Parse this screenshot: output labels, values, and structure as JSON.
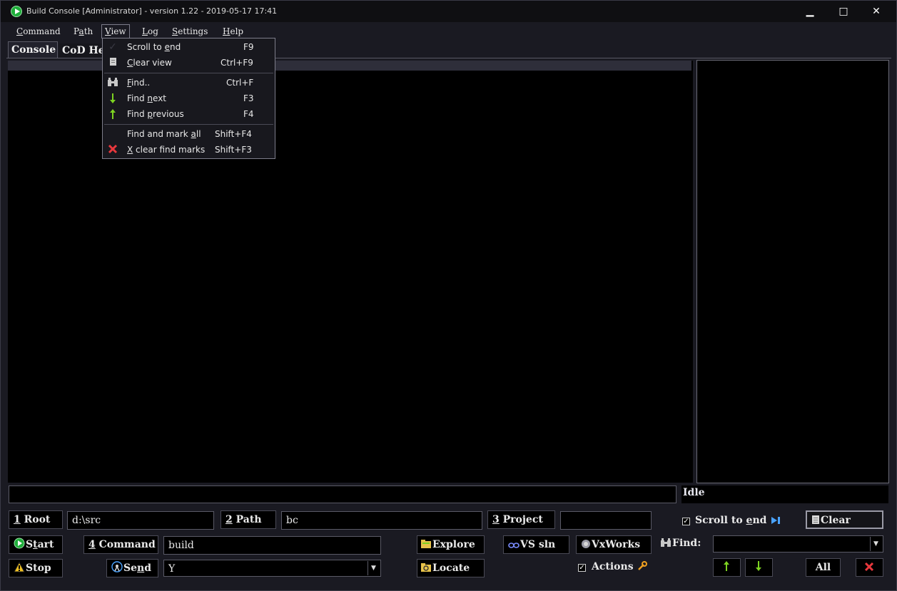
{
  "window": {
    "title": "Build Console [Administrator] - version 1.22 - 2019-05-17 17:41",
    "controls": {
      "minimize": "▁",
      "maximize": "□",
      "close": "✕"
    }
  },
  "menubar": {
    "items": [
      {
        "label": "Command",
        "accel_index": 0
      },
      {
        "label": "Path",
        "accel_index": 1
      },
      {
        "label": "View",
        "accel_index": 0,
        "open": true
      },
      {
        "label": "Log",
        "accel_index": 0
      },
      {
        "label": "Settings",
        "accel_index": 0
      },
      {
        "label": "Help",
        "accel_index": 0
      }
    ]
  },
  "view_menu": {
    "items": [
      {
        "pre": "Scroll to ",
        "accel": "e",
        "post": "nd",
        "shortcut": "F9",
        "icon": "check-icon"
      },
      {
        "pre": "",
        "accel": "C",
        "post": "lear view",
        "shortcut": "Ctrl+F9",
        "icon": "page-icon"
      },
      {
        "pre": "",
        "accel": "F",
        "post": "ind..",
        "shortcut": "Ctrl+F",
        "icon": "binoculars-icon"
      },
      {
        "pre": "Find ",
        "accel": "n",
        "post": "ext",
        "shortcut": "F3",
        "icon": "arrow-down-icon"
      },
      {
        "pre": "Find ",
        "accel": "p",
        "post": "revious",
        "shortcut": "F4",
        "icon": "arrow-up-icon"
      },
      {
        "pre": "Find and mark ",
        "accel": "a",
        "post": "ll",
        "shortcut": "Shift+F4",
        "icon": ""
      },
      {
        "pre": "",
        "accel": "X",
        "post": " clear find marks",
        "shortcut": "Shift+F3",
        "icon": "red-x-icon"
      }
    ]
  },
  "tabs": {
    "console": "Console",
    "cod": "CoD He"
  },
  "status": {
    "state": "Idle"
  },
  "row1": {
    "root_num": "1",
    "root_label": " Root",
    "root_value": "d:\\src",
    "path_num": "2",
    "path_label": " Path",
    "path_value": "bc",
    "project_num": "3",
    "project_label": " Project",
    "project_value": "",
    "scroll_label_pre": "Scroll to ",
    "scroll_label_accel": "e",
    "scroll_label_post": "nd",
    "clear_label": "Clear"
  },
  "row2": {
    "start_pre": "S",
    "start_accel": "t",
    "start_post": "art",
    "command_num": "4",
    "command_label": " Command",
    "command_value": "build",
    "explore_label": "Explore",
    "vssln_label": "VS sln",
    "vxworks_label": "VxWorks",
    "find_label": "Find:",
    "find_value": ""
  },
  "row3": {
    "stop_label": "Stop",
    "send_pre": "Se",
    "send_accel": "n",
    "send_post": "d",
    "send_value": "Y",
    "locate_label": "Locate",
    "actions_label": "Actions",
    "all_label": "All"
  },
  "colors": {
    "accent_green": "#7dd321",
    "error_red": "#e8383d",
    "link_blue": "#4aa3ff",
    "background": "#000000"
  }
}
